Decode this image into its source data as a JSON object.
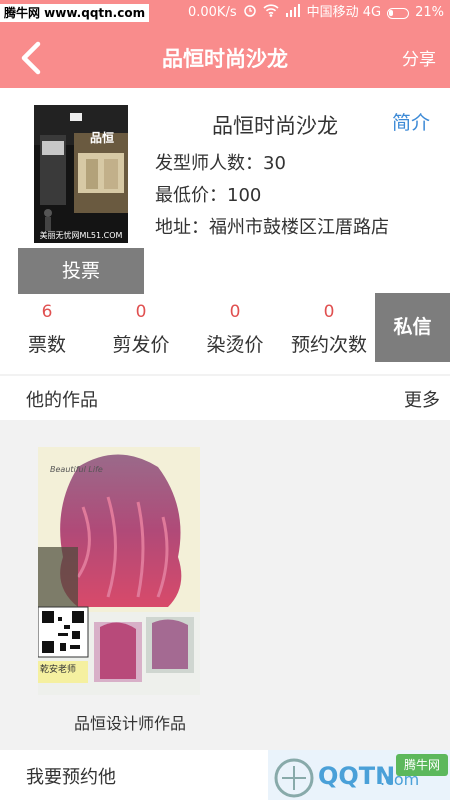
{
  "status_bar": {
    "watermark": "腾牛网 www.qqtn.com",
    "speed": "0.00K/s",
    "carrier": "中国移动 4G",
    "battery": "21%"
  },
  "nav": {
    "title": "品恒时尚沙龙",
    "share_label": "分享",
    "back_icon": "chevron-left-icon"
  },
  "salon": {
    "name": "品恒时尚沙龙",
    "intro_label": "简介",
    "stylist_count_label": "发型师人数：",
    "stylist_count": "30",
    "min_price_label": "最低价：",
    "min_price": "100",
    "address_label": "地址：",
    "address": "福州市鼓楼区江厝路店",
    "thumb_caption": "美丽无忧网ML51.COM",
    "store_sign": "品恒"
  },
  "vote_label": "投票",
  "private_msg_label": "私信",
  "stats": [
    {
      "value": "6",
      "label": "票数"
    },
    {
      "value": "0",
      "label": "剪发价"
    },
    {
      "value": "0",
      "label": "染烫价"
    },
    {
      "value": "0",
      "label": "预约次数"
    }
  ],
  "works": {
    "title": "他的作品",
    "more_label": "更多",
    "items": [
      {
        "caption": "品恒设计师作品",
        "stylist_tag": "乾安老师",
        "overlay_text": "Beautiful Life"
      }
    ]
  },
  "booking": {
    "title": "我要预约他"
  },
  "footer_logo": {
    "text": "QQTN",
    "suffix": ".com",
    "badge": "腾牛网"
  },
  "colors": {
    "brand": "#f98c8c",
    "link": "#3d8ad6",
    "stat_value": "#e05050",
    "button_gray": "#7d7d7d"
  }
}
